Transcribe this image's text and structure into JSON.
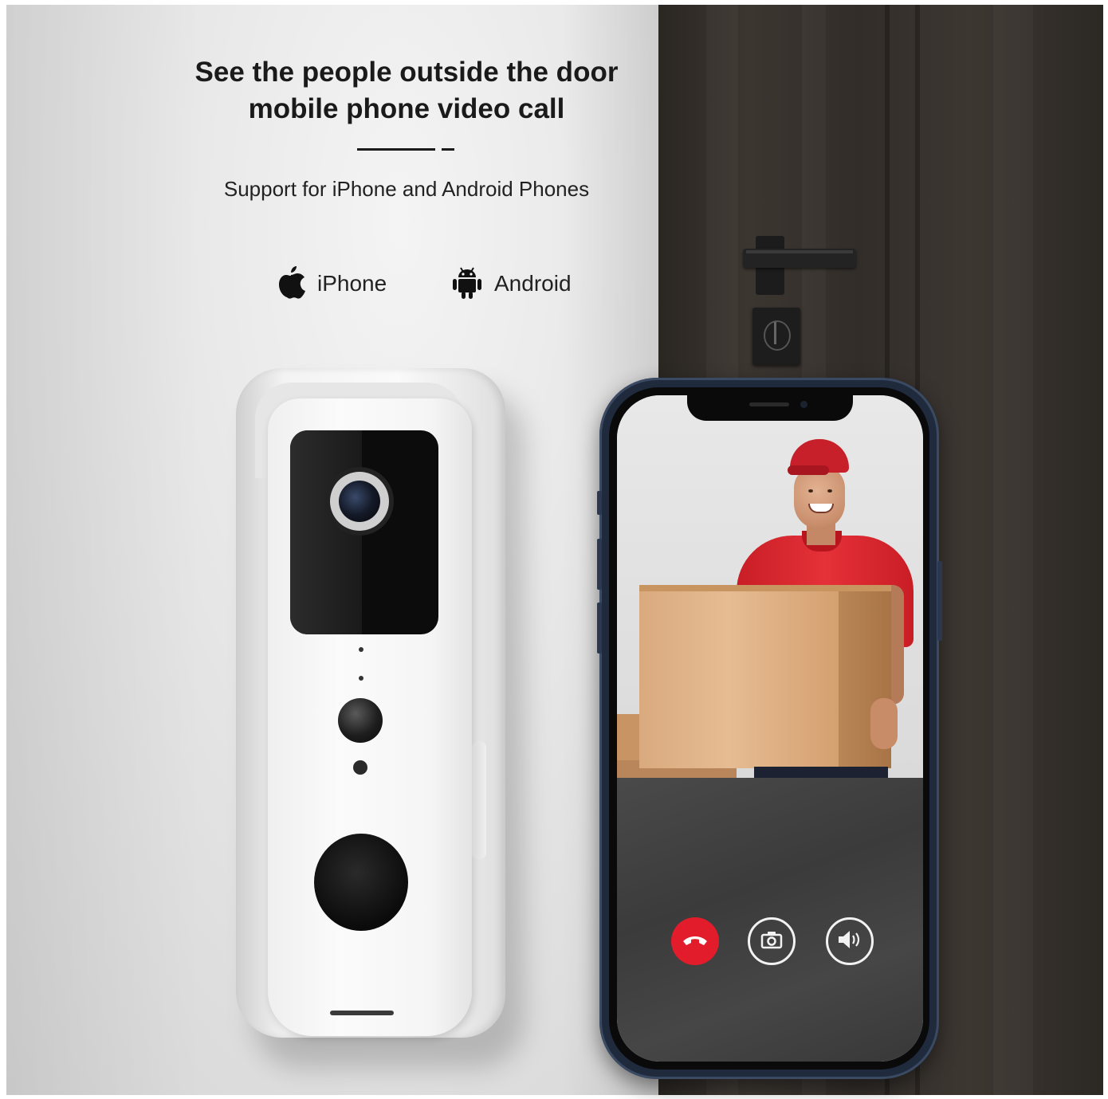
{
  "headline": {
    "line1": "See the people outside the door",
    "line2": "mobile phone video call"
  },
  "subline": "Support for iPhone and Android Phones",
  "platforms": [
    {
      "label": "iPhone",
      "icon": "apple-logo-icon"
    },
    {
      "label": "Android",
      "icon": "android-robot-icon"
    }
  ],
  "call_controls": [
    {
      "icon": "hang-up-icon",
      "color": "#e31c2b"
    },
    {
      "icon": "camera-snapshot-icon",
      "color": "#f2f2f2"
    },
    {
      "icon": "speaker-volume-icon",
      "color": "#f2f2f2"
    }
  ]
}
